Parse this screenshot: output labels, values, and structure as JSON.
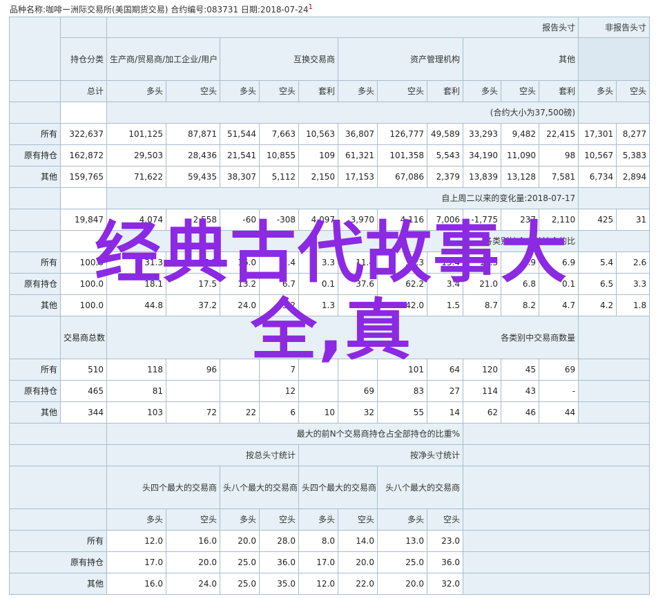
{
  "header": {
    "text": "品种名称:咖啡ー洲际交易所(美国期货交易)  合约编号:083731  日期:2018-07-24",
    "mark": "1"
  },
  "cols": {
    "report_top": "报告头寸",
    "nonreport_top": "非报告头寸",
    "position_class": "持仓分类",
    "producer": "生产商/贸易商/加工企业/用户",
    "swap": "互换交易商",
    "managed": "资产管理机构",
    "other": "其他",
    "total": "总计",
    "long": "多头",
    "short": "空头",
    "spread": "套利"
  },
  "rows": {
    "all": "所有",
    "old": "原有持仓",
    "other": "其他"
  },
  "s1": {
    "note": "(合约大小为37,500磅)",
    "data": [
      [
        "322,637",
        "101,125",
        "87,871",
        "51,544",
        "7,663",
        "10,563",
        "36,807",
        "126,777",
        "49,589",
        "33,293",
        "9,482",
        "22,415",
        "17,301",
        "8,277"
      ],
      [
        "162,872",
        "29,503",
        "28,436",
        "21,541",
        "10,855",
        "109",
        "61,321",
        "101,358",
        "5,543",
        "34,190",
        "11,090",
        "98",
        "10,567",
        "5,383"
      ],
      [
        "159,765",
        "71,622",
        "59,435",
        "38,307",
        "5,112",
        "2,150",
        "17,153",
        "67,086",
        "2,379",
        "13,839",
        "13,128",
        "7,581",
        "6,734",
        "2,894"
      ]
    ]
  },
  "s2": {
    "note": "自上周二以来的变化量:2018-07-17",
    "data": [
      "19,847",
      "4,074",
      "2,558",
      "-60",
      "-308",
      "4,097",
      "3,970",
      "4,116",
      "7,006",
      "-1,775",
      "237",
      "2,110",
      "425",
      "31"
    ]
  },
  "s3": {
    "note": "各类别持仓占总持仓的比",
    "data": [
      [
        "100.0",
        "31.3",
        "27.2",
        "16.0",
        "2.4",
        "3.3",
        "11.4",
        "39.3",
        "15.4",
        "10.3",
        "2.9",
        "6.9",
        "5.4",
        "2.6"
      ],
      [
        "100.0",
        "18.1",
        "17.5",
        "13.2",
        "6.7",
        "0.1",
        "37.6",
        "62.2",
        "3.4",
        "21.0",
        "6.8",
        "0.1",
        "6.5",
        "3.3"
      ],
      [
        "100.0",
        "44.8",
        "37.2",
        "24.0",
        "3.2",
        "1.3",
        "10.7",
        "42.0",
        "1.5",
        "8.7",
        "8.2",
        "4.7",
        "4.2",
        "1.8"
      ]
    ]
  },
  "s4": {
    "total_label": "交易商总数",
    "note": "各类别中交易商数量",
    "data": [
      [
        "510",
        "118",
        "96",
        "",
        "7",
        "",
        "",
        "101",
        "64",
        "120",
        "45",
        "69"
      ],
      [
        "465",
        "81",
        "",
        "",
        "12",
        "",
        "69",
        "83",
        "27",
        "114",
        "43",
        "-"
      ],
      [
        "344",
        "103",
        "72",
        "22",
        "6",
        "10",
        "32",
        "55",
        "14",
        "62",
        "46",
        "44"
      ]
    ]
  },
  "s5": {
    "title": "最大的前N个交易商持仓占全部持仓的比重%",
    "gross": "按总头寸统计",
    "net": "按净头寸统计",
    "top4": "头四个最大的交易商",
    "top8": "头八个最大的交易商",
    "data": [
      [
        "12.0",
        "16.0",
        "20.0",
        "28.0",
        "8.0",
        "14.0",
        "13.0",
        "23.0"
      ],
      [
        "17.0",
        "20.0",
        "25.0",
        "36.0",
        "17.0",
        "20.0",
        "25.0",
        "36.0"
      ],
      [
        "16.0",
        "24.0",
        "25.0",
        "35.0",
        "12.0",
        "22.0",
        "20.0",
        "32.0"
      ]
    ]
  },
  "watermark": {
    "line1": "经典古代故事大",
    "line2": "全,真"
  }
}
